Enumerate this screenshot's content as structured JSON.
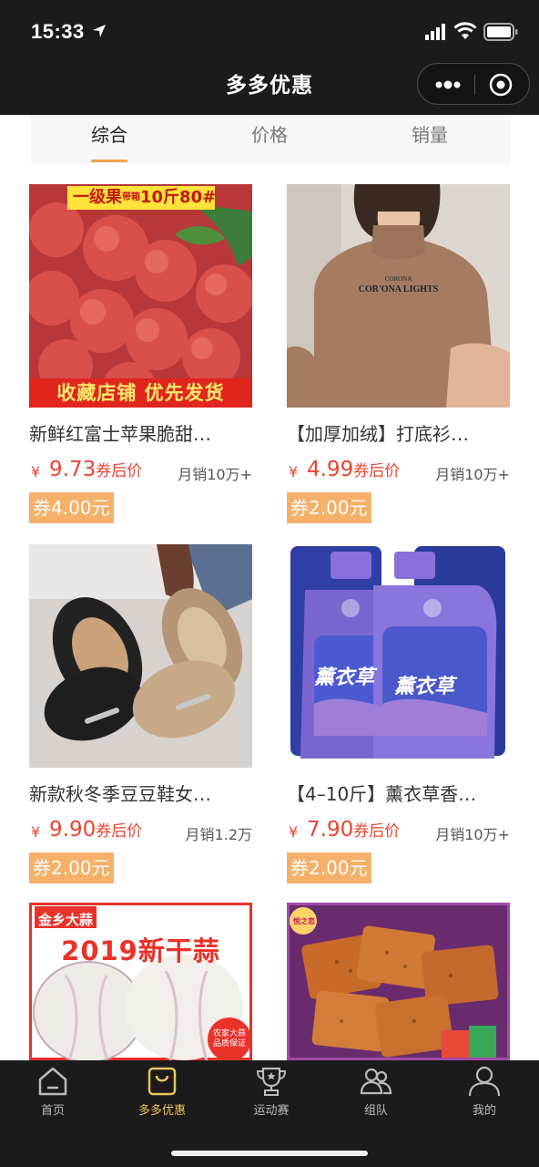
{
  "status_bar": {
    "time": "15:33"
  },
  "nav": {
    "title": "多多优惠"
  },
  "tabs": [
    {
      "label": "综合",
      "active": true
    },
    {
      "label": "价格",
      "active": false
    },
    {
      "label": "销量",
      "active": false
    }
  ],
  "products": [
    {
      "title": "新鲜红富士苹果脆甜…",
      "yen": "¥",
      "price": "9.73",
      "price_suffix": "券后价",
      "sales": "月销10万+",
      "coupon": "券4.00元",
      "banner_top": "一级果",
      "banner_top_small": "带箱",
      "banner_top_2": "10斤80#",
      "banner_bottom": "收藏店铺 优先发货"
    },
    {
      "title": "【加厚加绒】打底衫…",
      "yen": "¥",
      "price": "4.99",
      "price_suffix": "券后价",
      "sales": "月销10万+",
      "coupon": "券2.00元",
      "shirt_print_1": "CORONA",
      "shirt_print_2": "COR'ONA LIGHTS"
    },
    {
      "title": "新款秋冬季豆豆鞋女…",
      "yen": "¥",
      "price": "9.90",
      "price_suffix": "券后价",
      "sales": "月销1.2万",
      "coupon": "券2.00元"
    },
    {
      "title": "【4–10斤】薰衣草香…",
      "yen": "¥",
      "price": "7.90",
      "price_suffix": "券后价",
      "sales": "月销10万+",
      "coupon": "券2.00元",
      "bottle_label": "薰衣草"
    },
    {
      "banner_tag": "金乡大蒜",
      "banner_title": "2019新干蒜",
      "badge_line1": "农家大蒜",
      "badge_line2": "品质保证"
    },
    {
      "logo_text": "悦之恋"
    }
  ],
  "tabbar": [
    {
      "label": "首页",
      "icon": "home-icon",
      "active": false
    },
    {
      "label": "多多优惠",
      "icon": "shopping-bag-icon",
      "active": true
    },
    {
      "label": "运动赛",
      "icon": "trophy-icon",
      "active": false
    },
    {
      "label": "组队",
      "icon": "team-icon",
      "active": false
    },
    {
      "label": "我的",
      "icon": "user-icon",
      "active": false
    }
  ],
  "colors": {
    "accent": "#f2a24a",
    "price": "#e8452f",
    "coupon_bg": "#f5b06a",
    "tab_active": "#e9c35f",
    "header_bg": "#1b1b1b"
  }
}
